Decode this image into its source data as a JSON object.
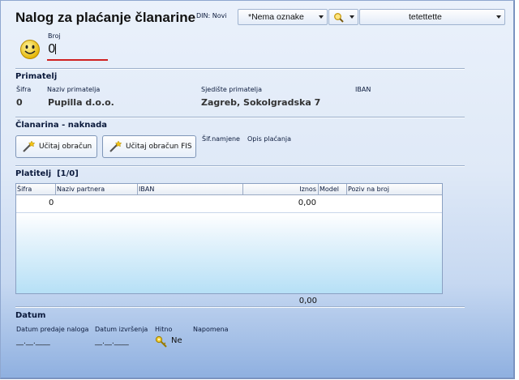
{
  "header": {
    "title": "Nalog za plaćanje članarine",
    "din": "DIN: Novi",
    "tag_select": "*Nema oznake",
    "search_label": "",
    "account_select": "tetettette"
  },
  "broj": {
    "label": "Broj",
    "value": "0"
  },
  "primatelj": {
    "section": "Primatelj",
    "sifra_label": "Šifra",
    "naziv_label": "Naziv primatelja",
    "sjediste_label": "Sjedište primatelja",
    "iban_label": "IBAN",
    "sifra": "0",
    "naziv": "Pupilla d.o.o.",
    "sjediste": "Zagreb, Sokolgradska 7"
  },
  "clanarina": {
    "section": "Članarina - naknada",
    "btn_ucitaj": "Učitaj obračun",
    "btn_ucitaj_fis": "Učitaj obračun FIS",
    "sif_namjene_label": "Šif.namjene",
    "opis_placanja_label": "Opis plaćanja"
  },
  "platitelj": {
    "section": "Platitelj",
    "counter": "[1/0]",
    "columns": [
      "Šifra",
      "Naziv partnera",
      "IBAN",
      "Iznos",
      "Model",
      "Poziv na broj"
    ],
    "rows": [
      {
        "sifra": "0",
        "naziv": "",
        "iban": "",
        "iznos": "0,00",
        "model": "",
        "poziv": ""
      }
    ],
    "total": "0,00"
  },
  "datum": {
    "section": "Datum",
    "predaje_label": "Datum predaje naloga",
    "izvrsenja_label": "Datum izvršenja",
    "hitno_label": "Hitno",
    "napomena_label": "Napomena",
    "predaje_value": "__.__.____",
    "izvrsenja_value": "__.__.____",
    "hitno_value": "Ne"
  },
  "colors": {
    "accent_underline": "#d02020",
    "key_icon": "#e0b820"
  }
}
